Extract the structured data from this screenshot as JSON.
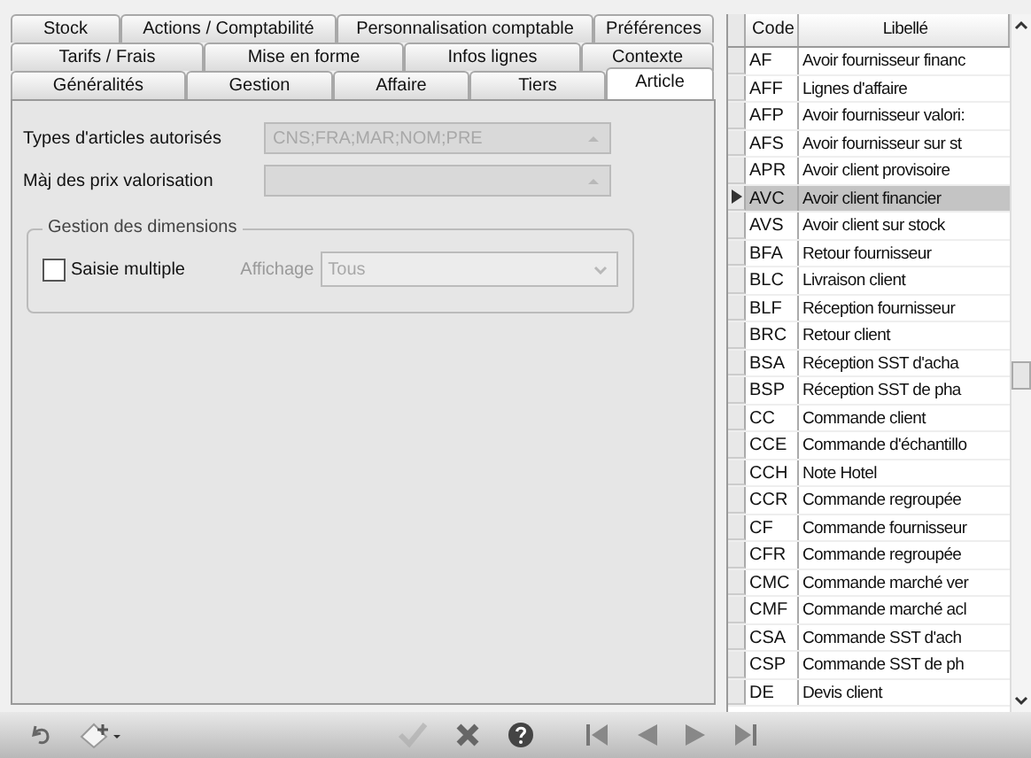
{
  "tab_rows": [
    [
      {
        "label": "Stock",
        "selected": false
      },
      {
        "label": "Actions / Comptabilité",
        "selected": false
      },
      {
        "label": "Personnalisation comptable",
        "selected": false
      },
      {
        "label": "Préférences",
        "selected": false
      }
    ],
    [
      {
        "label": "Tarifs / Frais",
        "selected": false
      },
      {
        "label": "Mise en forme",
        "selected": false
      },
      {
        "label": "Infos lignes",
        "selected": false
      },
      {
        "label": "Contexte",
        "selected": false
      }
    ],
    [
      {
        "label": "Généralités",
        "selected": false
      },
      {
        "label": "Gestion",
        "selected": false
      },
      {
        "label": "Affaire",
        "selected": false
      },
      {
        "label": "Tiers",
        "selected": false
      },
      {
        "label": "Article",
        "selected": true
      }
    ]
  ],
  "fields": [
    {
      "label": "Types d'articles autorisés",
      "value": "CNS;FRA;MAR;NOM;PRE",
      "disabled": true
    },
    {
      "label": "Màj des prix valorisation",
      "disabled": true
    }
  ],
  "dimensions": {
    "title": "Gestion des dimensions",
    "checkbox": {
      "label": "Saisie multiple",
      "checked": false
    },
    "display": {
      "label": "Affichage",
      "value": "Tous",
      "disabled": true
    }
  },
  "grid": {
    "columns": [
      "Code",
      "Libellé"
    ],
    "rows": [
      {
        "code": "AF",
        "label": "Avoir fournisseur financ",
        "selected": false
      },
      {
        "code": "AFF",
        "label": "Lignes d'affaire",
        "selected": false
      },
      {
        "code": "AFP",
        "label": "Avoir fournisseur valori:",
        "selected": false
      },
      {
        "code": "AFS",
        "label": "Avoir fournisseur sur st",
        "selected": false
      },
      {
        "code": "APR",
        "label": "Avoir client provisoire",
        "selected": false
      },
      {
        "code": "AVC",
        "label": "Avoir client financier",
        "selected": true
      },
      {
        "code": "AVS",
        "label": "Avoir client sur stock",
        "selected": false
      },
      {
        "code": "BFA",
        "label": "Retour fournisseur",
        "selected": false
      },
      {
        "code": "BLC",
        "label": "Livraison client",
        "selected": false
      },
      {
        "code": "BLF",
        "label": "Réception fournisseur",
        "selected": false
      },
      {
        "code": "BRC",
        "label": "Retour client",
        "selected": false
      },
      {
        "code": "BSA",
        "label": "Réception SST d'acha",
        "selected": false
      },
      {
        "code": "BSP",
        "label": "Réception SST de pha",
        "selected": false
      },
      {
        "code": "CC",
        "label": "Commande client",
        "selected": false
      },
      {
        "code": "CCE",
        "label": "Commande d'échantillo",
        "selected": false
      },
      {
        "code": "CCH",
        "label": "Note Hotel",
        "selected": false
      },
      {
        "code": "CCR",
        "label": "Commande regroupée",
        "selected": false
      },
      {
        "code": "CF",
        "label": "Commande fournisseur",
        "selected": false
      },
      {
        "code": "CFR",
        "label": "Commande regroupée",
        "selected": false
      },
      {
        "code": "CMC",
        "label": "Commande marché ver",
        "selected": false
      },
      {
        "code": "CMF",
        "label": "Commande marché acl",
        "selected": false
      },
      {
        "code": "CSA",
        "label": "Commande SST d'ach",
        "selected": false
      },
      {
        "code": "CSP",
        "label": "Commande SST de ph",
        "selected": false
      },
      {
        "code": "DE",
        "label": "Devis client",
        "selected": false
      }
    ]
  },
  "toolbar": [
    {
      "kind": "undo",
      "disabled": false
    },
    {
      "kind": "add",
      "disabled": false
    },
    {
      "kind": "validate",
      "disabled": true
    },
    {
      "kind": "cancel",
      "disabled": false
    },
    {
      "kind": "help",
      "disabled": false
    },
    {
      "kind": "first",
      "disabled": false
    },
    {
      "kind": "previous",
      "disabled": false
    },
    {
      "kind": "next",
      "disabled": false
    },
    {
      "kind": "last",
      "disabled": false
    }
  ]
}
